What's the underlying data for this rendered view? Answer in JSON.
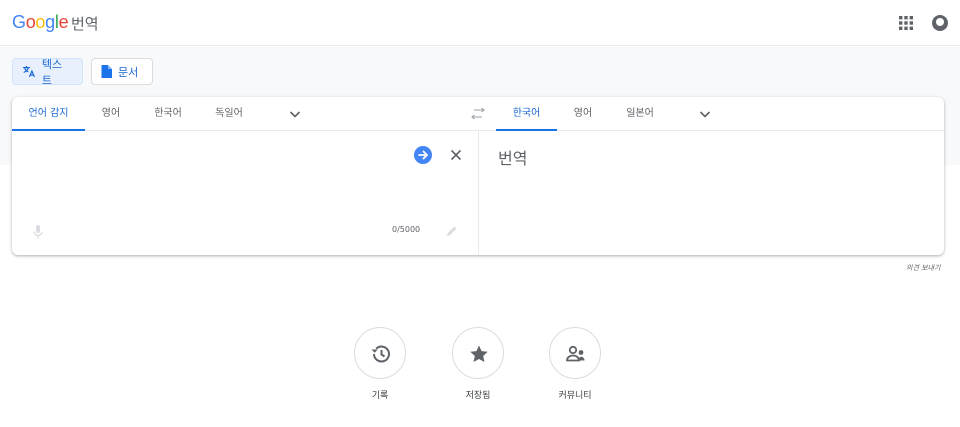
{
  "header": {
    "logo_letters": [
      {
        "ch": "G",
        "color": "#4285F4"
      },
      {
        "ch": "o",
        "color": "#EA4335"
      },
      {
        "ch": "o",
        "color": "#FBBC05"
      },
      {
        "ch": "g",
        "color": "#4285F4"
      },
      {
        "ch": "l",
        "color": "#34A853"
      },
      {
        "ch": "e",
        "color": "#EA4335"
      }
    ],
    "product_name": "번역",
    "icons": [
      "apps-icon",
      "account-icon"
    ]
  },
  "mode_tabs": [
    {
      "label": "텍스트",
      "icon": "translate-icon",
      "active": true
    },
    {
      "label": "문서",
      "icon": "document-icon",
      "active": false
    }
  ],
  "source_languages": [
    "언어 감지",
    "영어",
    "한국어",
    "독일어"
  ],
  "target_languages": [
    "한국어",
    "영어",
    "일본어"
  ],
  "source": {
    "counter": "0/5000"
  },
  "target": {
    "placeholder": "번역"
  },
  "feedback_link": "의견 보내기",
  "shortcuts": [
    {
      "label": "기록",
      "icon": "history-icon"
    },
    {
      "label": "저장됨",
      "icon": "star-icon"
    },
    {
      "label": "커뮤니티",
      "icon": "community-icon"
    }
  ],
  "colors": {
    "accent": "#1A73E8",
    "active_tab_text": "#1967D2",
    "active_mode_bg": "#E8F0FE"
  }
}
